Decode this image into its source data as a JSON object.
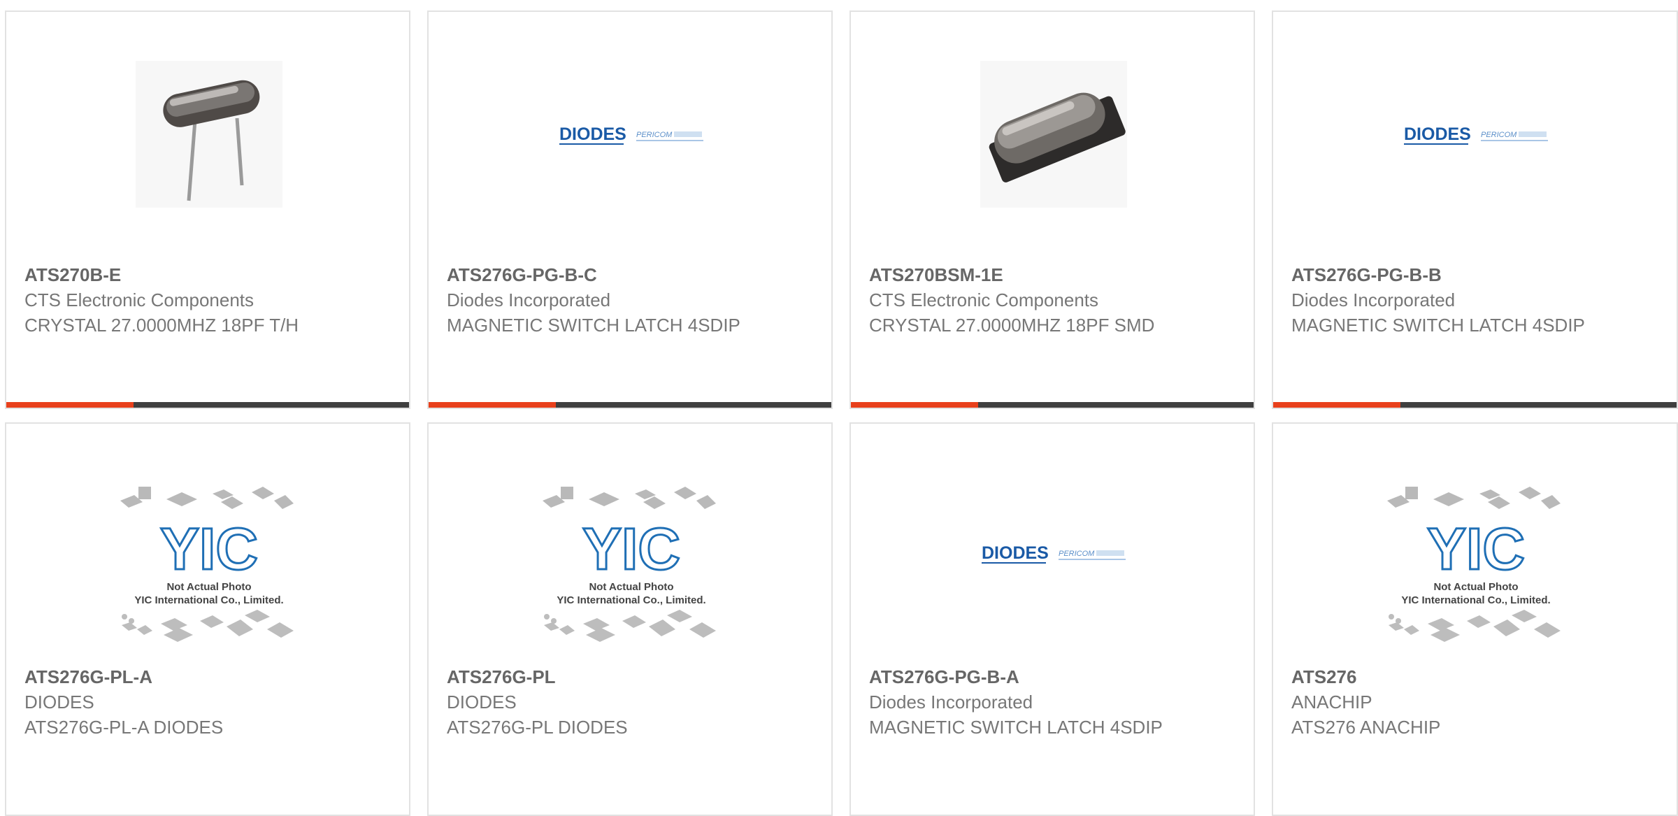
{
  "products": [
    {
      "part_number": "ATS270B-E",
      "manufacturer": "CTS Electronic Components",
      "description": "CRYSTAL 27.0000MHZ 18PF T/H",
      "image": "crystal-th-photo"
    },
    {
      "part_number": "ATS276G-PG-B-C",
      "manufacturer": "Diodes Incorporated",
      "description": "MAGNETIC SWITCH LATCH 4SDIP",
      "image": "diodes-pericom-logo"
    },
    {
      "part_number": "ATS270BSM-1E",
      "manufacturer": "CTS Electronic Components",
      "description": "CRYSTAL 27.0000MHZ 18PF SMD",
      "image": "crystal-smd-photo"
    },
    {
      "part_number": "ATS276G-PG-B-B",
      "manufacturer": "Diodes Incorporated",
      "description": "MAGNETIC SWITCH LATCH 4SDIP",
      "image": "diodes-pericom-logo"
    },
    {
      "part_number": "ATS276G-PL-A",
      "manufacturer": "DIODES",
      "description": "ATS276G-PL-A DIODES",
      "image": "yic-not-actual-photo"
    },
    {
      "part_number": "ATS276G-PL",
      "manufacturer": "DIODES",
      "description": "ATS276G-PL DIODES",
      "image": "yic-not-actual-photo"
    },
    {
      "part_number": "ATS276G-PG-B-A",
      "manufacturer": "Diodes Incorporated",
      "description": "MAGNETIC SWITCH LATCH 4SDIP",
      "image": "diodes-pericom-logo"
    },
    {
      "part_number": "ATS276",
      "manufacturer": "ANACHIP",
      "description": "ATS276 ANACHIP",
      "image": "yic-not-actual-photo"
    }
  ],
  "placeholder_image": {
    "line1": "Not Actual Photo",
    "line2": "YIC International Co., Limited.",
    "logo_text": "YIC"
  },
  "diodes_logo": {
    "brand": "DIODES",
    "sub_brand": "PERICOM"
  },
  "colors": {
    "accent": "#e8401c",
    "bar": "#3f3f3f",
    "text": "#777777",
    "part_number": "#666666",
    "border": "#e2e2e2",
    "diodes_blue": "#1a5aa6",
    "yic_blue": "#1f6fb5"
  }
}
